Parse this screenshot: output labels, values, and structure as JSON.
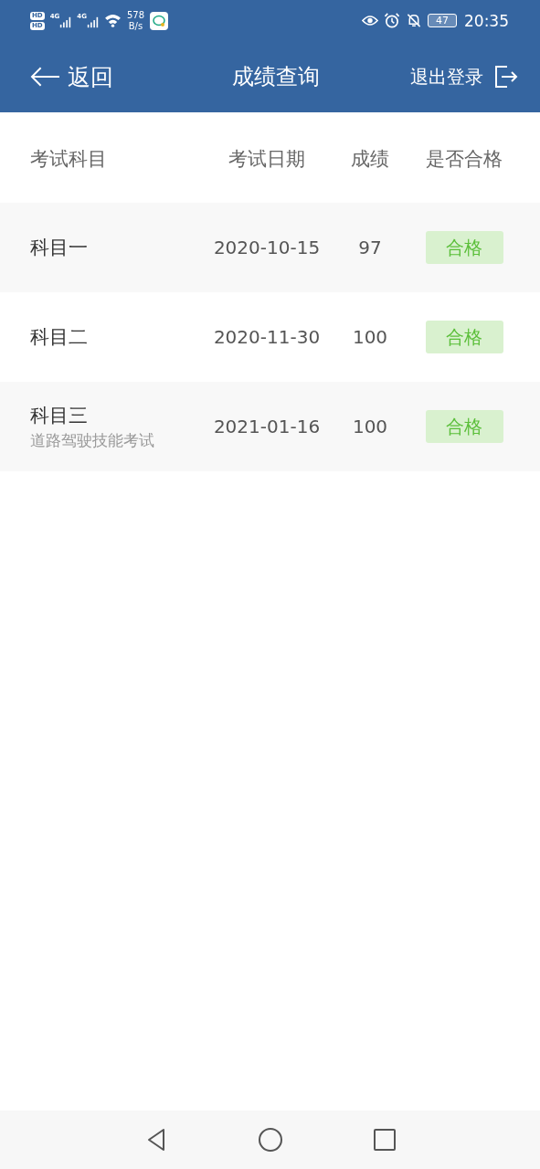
{
  "status_bar": {
    "hd_badges": [
      "HD",
      "HD"
    ],
    "network_labels": [
      "4G",
      "4G"
    ],
    "speed_value": "578",
    "speed_unit": "B/s",
    "battery": "47",
    "time": "20:35"
  },
  "header": {
    "back": "返回",
    "title": "成绩查询",
    "logout": "退出登录"
  },
  "table": {
    "columns": [
      "考试科目",
      "考试日期",
      "成绩",
      "是否合格"
    ],
    "rows": [
      {
        "subject": "科目一",
        "date": "2020-10-15",
        "score": "97",
        "result": "合格",
        "passed": true
      },
      {
        "subject": "科目二",
        "date": "2020-11-30",
        "score": "100",
        "result": "合格",
        "passed": true
      },
      {
        "subject": "科目三",
        "subtitle": "道路驾驶技能考试",
        "date": "2021-01-16",
        "score": "100",
        "result": "合格",
        "passed": true
      }
    ]
  }
}
